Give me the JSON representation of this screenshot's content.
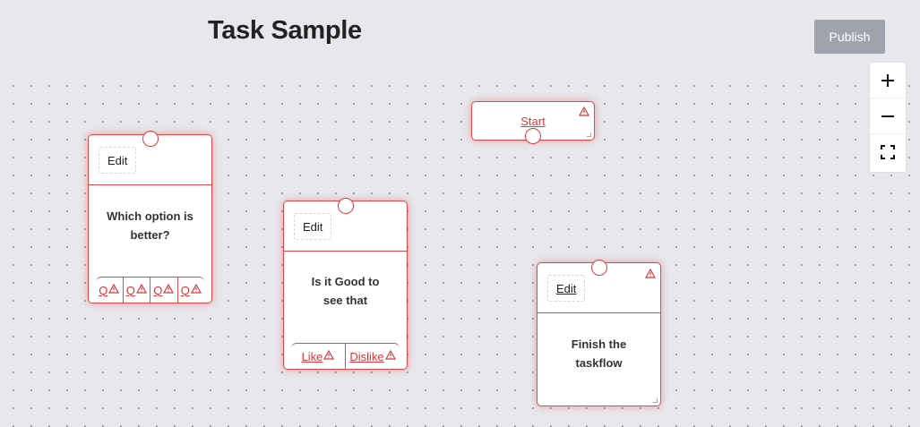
{
  "header": {
    "title": "Task Sample",
    "publish_label": "Publish"
  },
  "zoom": {
    "zoom_in_icon": "plus-icon",
    "zoom_out_icon": "minus-icon",
    "fit_icon": "fit-view-icon"
  },
  "colors": {
    "error_border": "#e2474a",
    "error_text": "#d8383b",
    "publish_bg": "#9ea3ad",
    "canvas_bg": "#e8e8ec"
  },
  "nodes": {
    "start": {
      "label": "Start"
    },
    "question1": {
      "edit_label": "Edit",
      "question": "Which option is better?",
      "answers": [
        "Q",
        "Q",
        "Q",
        "Q"
      ]
    },
    "question2": {
      "edit_label": "Edit",
      "question": "Is it Good to see that",
      "answers": [
        "Like",
        "Dislike"
      ]
    },
    "end": {
      "edit_label": "Edit",
      "text": "Finish the taskflow"
    }
  }
}
